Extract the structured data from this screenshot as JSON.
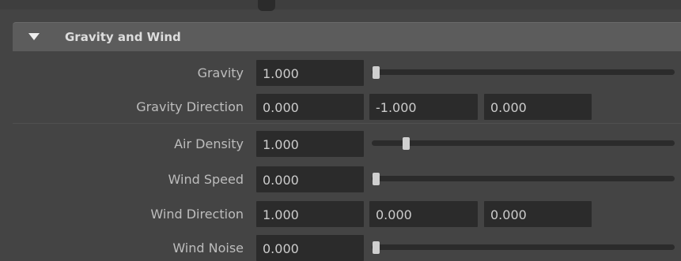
{
  "section": {
    "title": "Gravity and Wind",
    "expand_icon": "triangle-down-icon"
  },
  "attributes": {
    "gravity": {
      "label": "Gravity",
      "value": "1.000",
      "slider_fraction": 0.0
    },
    "gravity_direction": {
      "label": "Gravity Direction",
      "x": "0.000",
      "y": "-1.000",
      "z": "0.000"
    },
    "air_density": {
      "label": "Air Density",
      "value": "1.000",
      "slider_fraction": 0.1
    },
    "wind_speed": {
      "label": "Wind Speed",
      "value": "0.000",
      "slider_fraction": 0.0
    },
    "wind_direction": {
      "label": "Wind Direction",
      "x": "1.000",
      "y": "0.000",
      "z": "0.000"
    },
    "wind_noise": {
      "label": "Wind Noise",
      "value": "0.000",
      "slider_fraction": 0.0
    }
  },
  "colors": {
    "panel_bg": "#444444",
    "header_bg": "#5c5c5c",
    "field_bg": "#2b2b2b",
    "label_text": "#bdbdbd",
    "field_text": "#cccccc"
  }
}
